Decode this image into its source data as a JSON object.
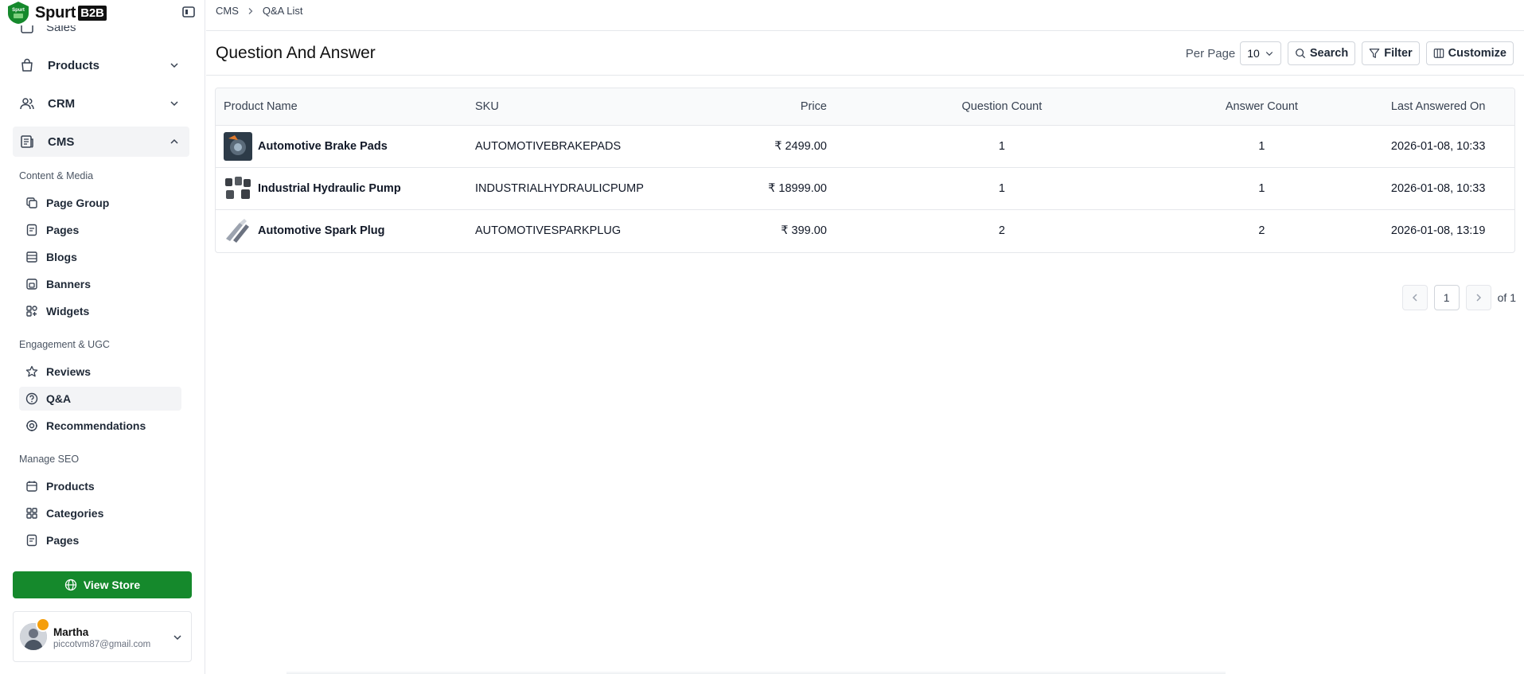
{
  "brand": {
    "name": "Spurt",
    "suffix": "B2B",
    "logo_text": "Spurt"
  },
  "sidebar": {
    "partial_item": "Sales",
    "main_items": [
      {
        "label": "Products",
        "icon": "shopping-bag-icon"
      },
      {
        "label": "CRM",
        "icon": "users-icon"
      },
      {
        "label": "CMS",
        "icon": "newspaper-icon"
      }
    ],
    "sections": [
      {
        "title": "Content & Media",
        "items": [
          {
            "label": "Page Group",
            "icon": "copy-icon"
          },
          {
            "label": "Pages",
            "icon": "file-text-icon"
          },
          {
            "label": "Blogs",
            "icon": "blog-icon"
          },
          {
            "label": "Banners",
            "icon": "banner-icon"
          },
          {
            "label": "Widgets",
            "icon": "widgets-icon"
          }
        ]
      },
      {
        "title": "Engagement & UGC",
        "items": [
          {
            "label": "Reviews",
            "icon": "star-icon"
          },
          {
            "label": "Q&A",
            "icon": "question-circle-icon"
          },
          {
            "label": "Recommendations",
            "icon": "recommend-icon"
          }
        ]
      },
      {
        "title": "Manage SEO",
        "items": [
          {
            "label": "Products",
            "icon": "calendar-box-icon"
          },
          {
            "label": "Categories",
            "icon": "grid-icon"
          },
          {
            "label": "Pages",
            "icon": "file-text-icon"
          }
        ]
      }
    ],
    "view_store": "View Store",
    "user": {
      "name": "Martha",
      "email": "piccotvm87@gmail.com"
    }
  },
  "breadcrumb": {
    "parent": "CMS",
    "current": "Q&A List"
  },
  "header": {
    "title": "Question And Answer",
    "per_page_label": "Per Page",
    "per_page_value": "10",
    "search": "Search",
    "filter": "Filter",
    "customize": "Customize"
  },
  "table": {
    "columns": [
      "Product Name",
      "SKU",
      "Price",
      "Question Count",
      "Answer Count",
      "Last Answered On"
    ],
    "rows": [
      {
        "name": "Automotive Brake Pads",
        "sku": "AUTOMOTIVEBRAKEPADS",
        "price": "₹ 2499.00",
        "questions": "1",
        "answers": "1",
        "last": "2026-01-08, 10:33"
      },
      {
        "name": "Industrial Hydraulic Pump",
        "sku": "INDUSTRIALHYDRAULICPUMP",
        "price": "₹ 18999.00",
        "questions": "1",
        "answers": "1",
        "last": "2026-01-08, 10:33"
      },
      {
        "name": "Automotive Spark Plug",
        "sku": "AUTOMOTIVESPARKPLUG",
        "price": "₹ 399.00",
        "questions": "2",
        "answers": "2",
        "last": "2026-01-08, 13:19"
      }
    ]
  },
  "pagination": {
    "current": "1",
    "of_label": "of 1"
  },
  "colors": {
    "accent": "#15892c",
    "border": "#e5e7eb",
    "active_bg": "#f3f4f6"
  }
}
